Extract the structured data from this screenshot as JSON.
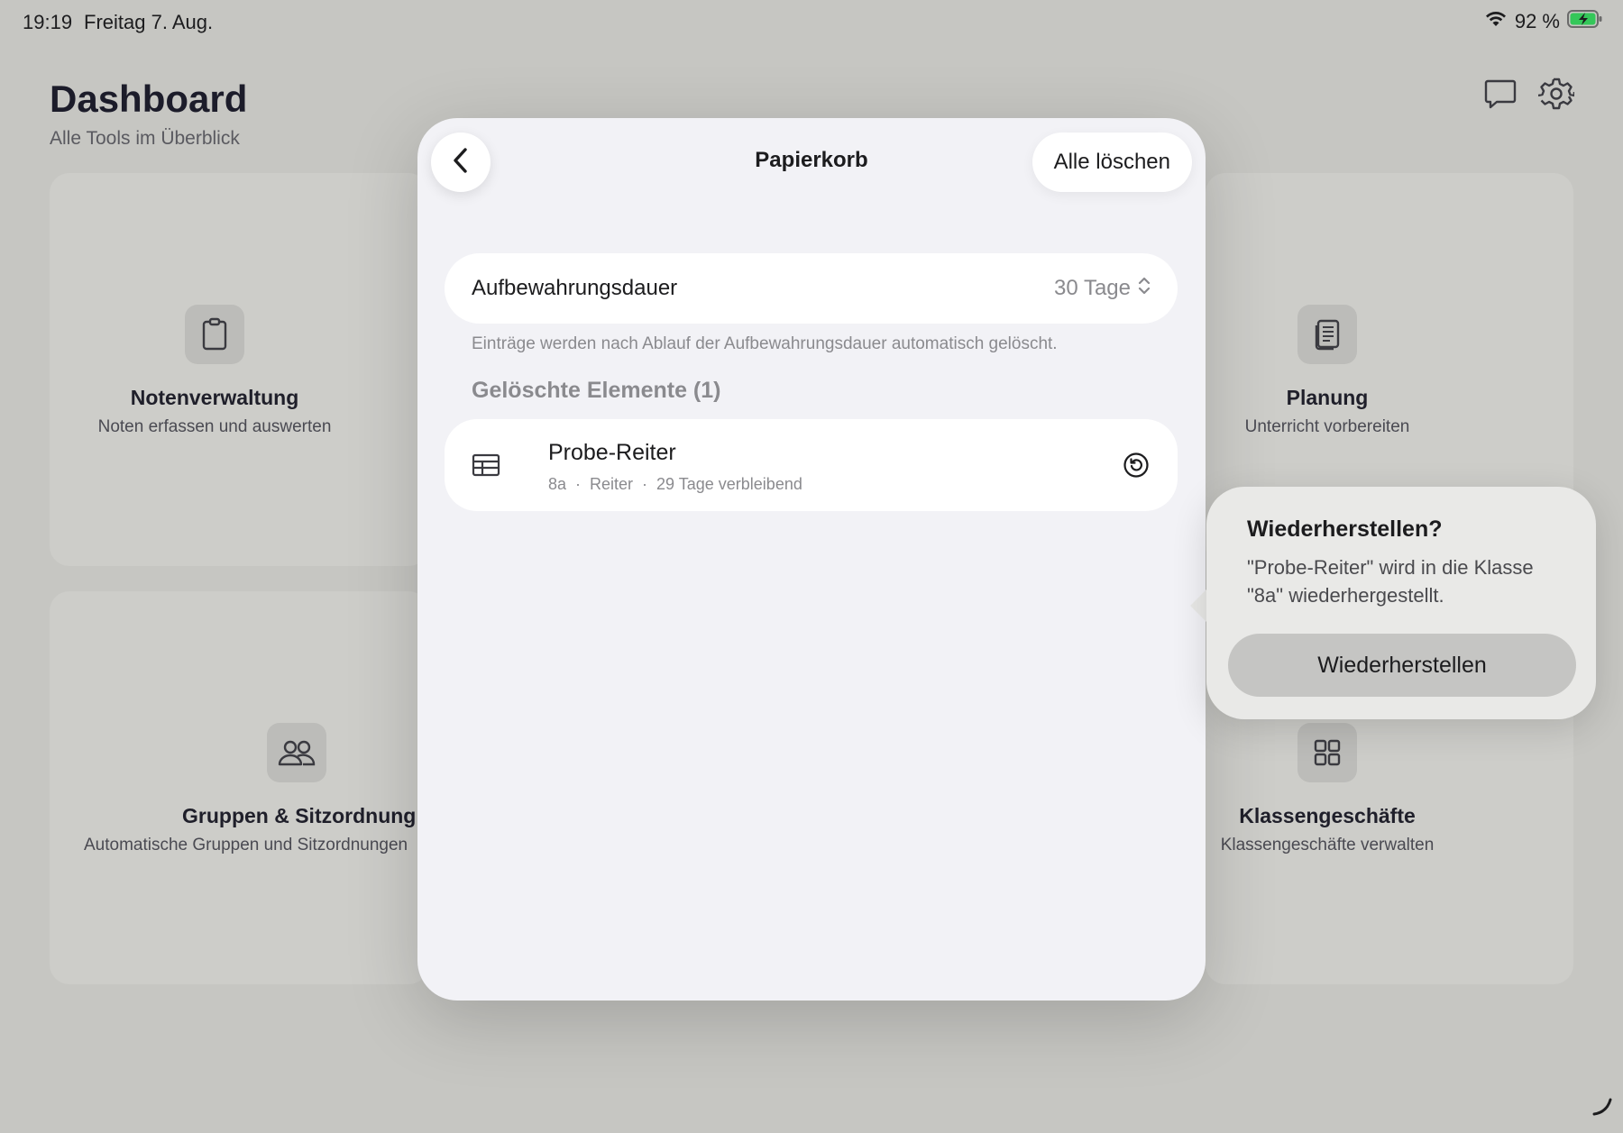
{
  "status_bar": {
    "time": "19:19",
    "date": "Freitag 7. Aug.",
    "battery": "92 %",
    "wifi_icon": "wifi-icon",
    "battery_icon": "battery-charging-icon"
  },
  "header": {
    "title": "Dashboard",
    "subtitle": "Alle Tools im Überblick",
    "icons": [
      "chat-bubble-icon",
      "gear-icon"
    ]
  },
  "tools": [
    {
      "title": "Notenverwaltung",
      "subtitle": "Noten erfassen und auswerten",
      "icon": "clipboard-icon"
    },
    {
      "title": "Planung",
      "subtitle": "Unterricht vorbereiten",
      "icon": "document-icon"
    },
    {
      "title": "Gruppen & Sitzordnung",
      "subtitle": "Automatische Gruppen und Sitzordnungen",
      "icon": "people-icon"
    },
    {
      "title": "Klassengeschäfte",
      "subtitle": "Klassengeschäfte verwalten",
      "icon": "grid-icon"
    }
  ],
  "modal": {
    "title": "Papierkorb",
    "clear_all": "Alle löschen",
    "retention_label": "Aufbewahrungsdauer",
    "retention_value": "30 Tage",
    "retention_note": "Einträge werden nach Ablauf der Aufbewahrungsdauer automatisch gelöscht.",
    "section_header": "Gelöschte Elemente (1)",
    "items": [
      {
        "title": "Probe-Reiter",
        "class": "8a",
        "type": "Reiter",
        "remaining": "29 Tage verbleibend",
        "icon": "table-icon"
      }
    ]
  },
  "popover": {
    "title": "Wiederherstellen?",
    "message": "\"Probe-Reiter\" wird in die Klasse \"8a\" wiederhergestellt.",
    "button": "Wiederherstellen"
  },
  "colors": {
    "background": "#c6c6c2",
    "modal": "#f2f2f6",
    "popover": "#e9e9e7",
    "battery": "#34c759"
  }
}
